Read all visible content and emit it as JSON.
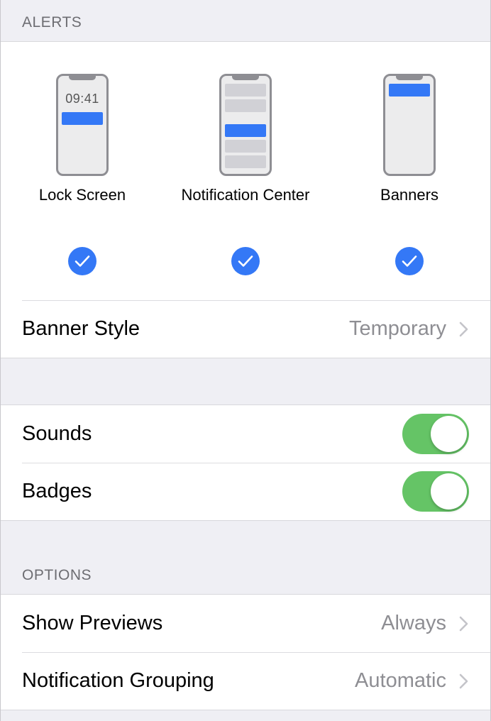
{
  "alerts": {
    "header": "ALERTS",
    "options": [
      {
        "label": "Lock Screen",
        "clock": "09:41",
        "checked": true
      },
      {
        "label": "Notification Center",
        "checked": true
      },
      {
        "label": "Banners",
        "checked": true
      }
    ],
    "banner_style": {
      "label": "Banner Style",
      "value": "Temporary"
    }
  },
  "toggles": {
    "sounds": {
      "label": "Sounds",
      "on": true
    },
    "badges": {
      "label": "Badges",
      "on": true
    }
  },
  "options": {
    "header": "OPTIONS",
    "show_previews": {
      "label": "Show Previews",
      "value": "Always"
    },
    "grouping": {
      "label": "Notification Grouping",
      "value": "Automatic"
    }
  },
  "colors": {
    "accent_blue": "#3478f6",
    "toggle_green": "#65c466",
    "secondary_text": "#8e8e93",
    "background": "#efeff4"
  },
  "icons": [
    "checkmark-icon",
    "chevron-right-icon",
    "phone-preview-icon"
  ]
}
